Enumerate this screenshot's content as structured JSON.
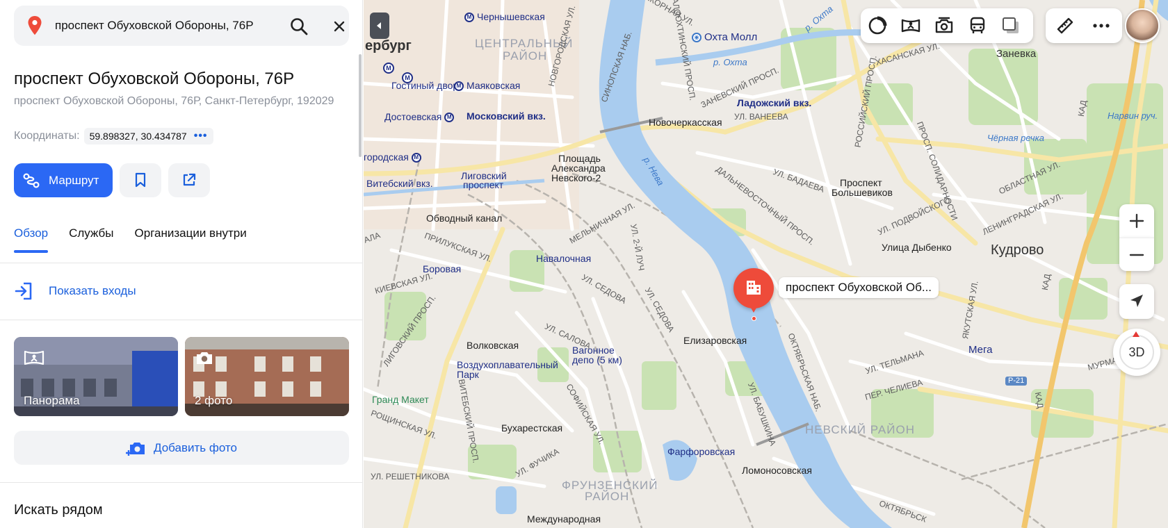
{
  "search": {
    "value": "проспект Обуховской Обороны, 76Р"
  },
  "place": {
    "title": "проспект Обуховской Обороны, 76Р",
    "address": "проспект Обуховской Обороны, 76Р, Санкт-Петербург, 192029",
    "coords_label": "Координаты:",
    "coords_value": "59.898327, 30.434787",
    "coords_more": "•••"
  },
  "actions": {
    "route_label": "Маршрут"
  },
  "tabs": [
    {
      "label": "Обзор",
      "active": true
    },
    {
      "label": "Службы",
      "active": false
    },
    {
      "label": "Организации внутри",
      "active": false
    }
  ],
  "entrances": {
    "label": "Показать входы"
  },
  "photos": {
    "panorama_label": "Панорама",
    "photos_label": "2 фото"
  },
  "add_photo": {
    "label": "Добавить фото"
  },
  "nearby": {
    "title": "Искать рядом"
  },
  "map": {
    "marker_label": "проспект Обуховской Об...",
    "zoom_in": "+",
    "zoom_out": "−",
    "btn_3d": "3D",
    "labels": {
      "city_spb": "ербург",
      "chernyshevskaya": "Чернышевская",
      "central_district": "ЦЕНТРАЛЬНЫЙ",
      "central_district2": "РАЙОН",
      "mayakovskaya": "Маяковская",
      "gostiny": "Гостиный двор",
      "dostoevskaya": "Достоевская",
      "moskovsky_vkz": "Московский вкз.",
      "gorodskaya": "городская",
      "vitebsky": "Витебский вкз.",
      "ligovsky": "Лиговский",
      "ligovsky2": "проспект",
      "pl_alexandra": "Площадь",
      "pl_alexandra2": "Александра",
      "pl_alexandra3": "Невского-2",
      "novocherkasskaya": "Новочеркасская",
      "okhta_moll": "Охта Молл",
      "ladozhsky": "Ладожский вкз.",
      "r_okhta": "р. Охта",
      "r_okhta2": "р. Охта",
      "zanevka": "Заневка",
      "obvodny": "Обводный канал",
      "r_neva": "р. Нева",
      "prospekt_bolsh": "Проспект",
      "prospekt_bolsh2": "Большевиков",
      "ulitsa_dybenko": "Улица Дыбенко",
      "kudrovo": "Кудрово",
      "chernaya_rechka": "Чёрная речка",
      "narvin_ruch": "Нарвин руч.",
      "borovaya": "Боровая",
      "navalochnaya": "Навалочная",
      "volkovskaya": "Волковская",
      "vagonnoe": "Вагонное",
      "vagonnoe2": "депо (5 км)",
      "elizarovskaya": "Елизаровская",
      "vozdukh": "Воздухоплавательный",
      "vozdukh2": "Парк",
      "grand_maket": "Гранд Макет",
      "bukharestskaya": "Бухарестская",
      "farforovskaya": "Фарфоровская",
      "lomonosovskaya": "Ломоносовская",
      "nevsky_district": "НЕВСКИЙ РАЙОН",
      "frunzensky": "ФРУНЗЕНСКИЙ",
      "frunzensky2": "РАЙОН",
      "mezhdunarodnaya": "Международная",
      "mega": "Мега",
      "r21": "Р-21",
      "kad": "КАД",
      "st_yakornaya": "ЯКОРНАЯ УЛ.",
      "st_zanevsky": "ЗАНЕВСКИЙ ПРОСП.",
      "st_vaneeva": "УЛ. ВАНЕЕВА",
      "st_badaeva": "УЛ. БАДАЕВА",
      "st_dalnevost": "ДАЛЬНЕВОСТОЧНЫЙ ПРОСП.",
      "st_podvoisky": "УЛ. ПОДВОЙСКОГО",
      "st_leningradskaya": "ЛЕНИНГРАДСКАЯ УЛ.",
      "st_oblastnaya": "ОБЛАСТНАЯ УЛ.",
      "st_khasanskaya": "ХАСАНСКАЯ УЛ.",
      "st_sedova": "УЛ. СЕДОВА",
      "st_sedova2": "УЛ. СЕДОВА",
      "st_salova": "УЛ. САЛОВА",
      "st_prilukskaya": "ПРИЛУКСКАЯ УЛ.",
      "st_kievskaya": "КИЕВСКАЯ УЛ.",
      "st_ligovsky": "ЛИГОВСКИЙ ПРОСП.",
      "st_vitebsky": "ВИТЕБСКИЙ ПРОСП.",
      "st_sofiyskaya": "СОФИЙСКАЯ УЛ.",
      "st_fuchika": "УЛ. ФУЧИКА",
      "st_reshetnikova": "УЛ. РЕШЕТНИКОВА",
      "st_roshinskaya": "РОЩИНСКАЯ УЛ.",
      "st_babushkina": "УЛ. БАБУШКИНА",
      "st_oktyabrskaya": "ОКТЯБРЬСКАЯ НАБ.",
      "st_telmana": "УЛ. ТЕЛЬМАНА",
      "st_chelieva": "ПЕР. ЧЕЛИЕВА",
      "st_murmanskoe": "МУРМАНСКОЕ Ш.",
      "st_melnichnaya": "МЕЛЬНИЧНАЯ УЛ.",
      "st_2luch": "УЛ. 2-Й ЛУЧ",
      "st_malookhtinsky": "МАЛООХТИНСКИЙ ПРОСП.",
      "st_sinopskaya": "СИНОПСКАЯ НАБ.",
      "st_rossiysky": "РОССИЙСКИЙ ПРОСП.",
      "st_solidarnosti": "ПРОСП. СОЛИДАРНОСТИ",
      "st_yakutskaya": "ЯКУТСКАЯ УЛ.",
      "st_novgorodskaya": "НОВГОРОДСКАЯ УЛ.",
      "st_ala": "АЛА",
      "st_oktyabrskaya2": "ОКТЯБРЬСК"
    }
  },
  "colors": {
    "accent": "#2b68f4",
    "link": "#1a5fdc",
    "marker": "#ee4b3a",
    "water": "#a9ccef",
    "park": "#c9e2b3"
  },
  "icons": {
    "search_pin": "map-pin-icon",
    "search": "search-icon",
    "close": "close-icon",
    "route": "route-icon",
    "bookmark": "bookmark-icon",
    "share": "share-icon",
    "entrances": "entrance-icon",
    "panorama": "panorama-icon",
    "camera": "camera-icon",
    "add_photo": "add-photo-icon"
  }
}
